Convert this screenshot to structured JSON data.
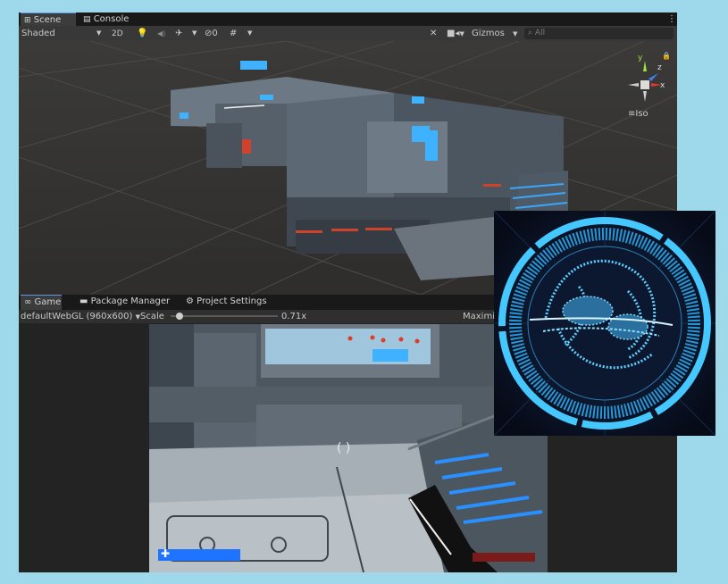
{
  "tabs_top": [
    {
      "icon": "grid-icon",
      "label": "Scene"
    },
    {
      "icon": "console-icon",
      "label": "Console"
    }
  ],
  "scene_toolbar": {
    "shading": "Shaded",
    "mode_2d": "2D",
    "hidden_count": "0",
    "gizmos": "Gizmos",
    "search_placeholder": "All"
  },
  "orientation_gizmo": {
    "y": "y",
    "z": "z",
    "x": "x",
    "projection": "Iso"
  },
  "tabs_bottom": [
    {
      "icon": "gamepad-icon",
      "label": "Game"
    },
    {
      "icon": "package-icon",
      "label": "Package Manager"
    },
    {
      "icon": "gear-icon",
      "label": "Project Settings"
    }
  ],
  "game_toolbar": {
    "resolution": "defaultWebGL (960x600)",
    "scale_label": "Scale",
    "scale_value": "0.71x",
    "scale_level": 0.05,
    "maximize": "Maximi"
  },
  "hud": {
    "health_fraction": 1.0,
    "health_icon": "plus-icon",
    "enemy_fraction": 1.0
  },
  "colors": {
    "accent": "#5a9ae6",
    "hud_blue": "#1e74ff",
    "hud_red": "#7a1a1a",
    "neon": "#44c8ff"
  }
}
